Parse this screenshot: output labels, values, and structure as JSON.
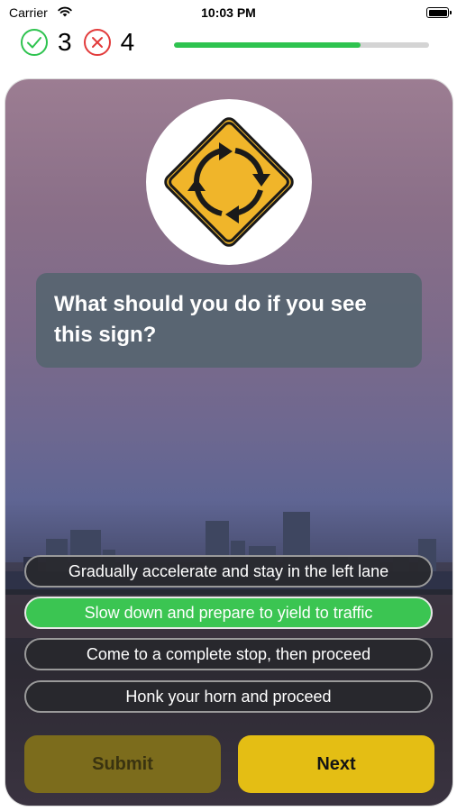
{
  "status_bar": {
    "carrier": "Carrier",
    "time": "10:03 PM"
  },
  "score": {
    "correct": "3",
    "incorrect": "4",
    "progress": 0.73
  },
  "question": {
    "text": "What should you do if you see this sign?",
    "sign_icon": "roundabout-sign-icon"
  },
  "answers": [
    {
      "label": "Gradually accelerate and stay in the left lane",
      "selected": false
    },
    {
      "label": "Slow down and prepare to yield to traffic",
      "selected": true
    },
    {
      "label": "Come to a complete stop, then proceed",
      "selected": false
    },
    {
      "label": "Honk your horn and proceed",
      "selected": false
    }
  ],
  "buttons": {
    "submit": "Submit",
    "next": "Next"
  },
  "colors": {
    "correct": "#2ec34f",
    "incorrect": "#e23b3b",
    "selected": "#3bc552",
    "next": "#e4be14",
    "submit": "#7c6c1c"
  }
}
